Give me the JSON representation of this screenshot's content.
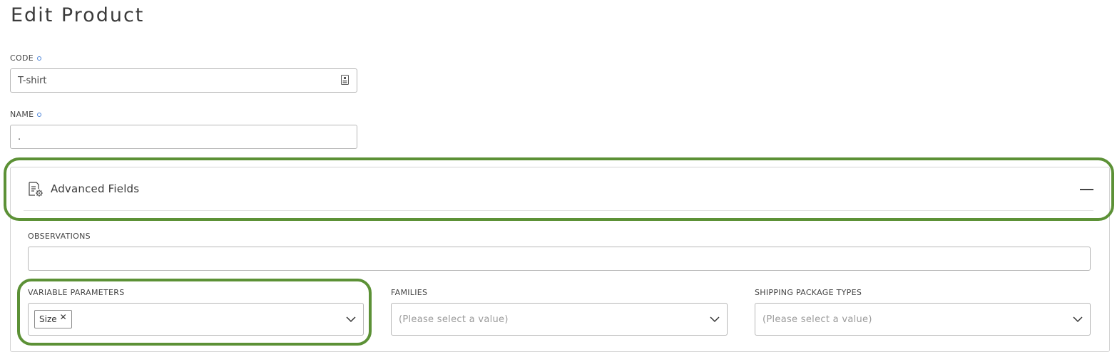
{
  "page": {
    "title": "Edit Product"
  },
  "form": {
    "code": {
      "label": "CODE",
      "value": "T-shirt"
    },
    "name": {
      "label": "NAME",
      "value": "."
    }
  },
  "advanced": {
    "title": "Advanced Fields",
    "observations": {
      "label": "OBSERVATIONS",
      "value": ""
    },
    "variable_parameters": {
      "label": "VARIABLE PARAMETERS",
      "chips": [
        "Size"
      ]
    },
    "families": {
      "label": "FAMILIES",
      "placeholder": "(Please select a value)"
    },
    "shipping_package_types": {
      "label": "SHIPPING PACKAGE TYPES",
      "placeholder": "(Please select a value)"
    }
  },
  "colors": {
    "highlight": "#5c9136",
    "required_dot": "#4a83d8"
  },
  "icons": {
    "code_field": "id-card-icon",
    "panel": "document-settings-icon",
    "collapse": "minus-icon",
    "dropdown": "chevron-down-icon",
    "chip_remove": "close-icon"
  }
}
